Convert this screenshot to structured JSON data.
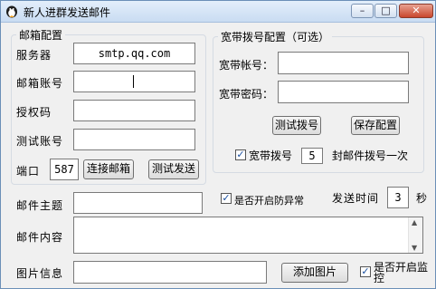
{
  "window": {
    "title": "新人进群发送邮件",
    "minimize_icon": "minimize-icon",
    "maximize_icon": "maximize-icon",
    "close_icon": "close-icon"
  },
  "mail_config": {
    "legend": "邮箱配置",
    "server_label": "服务器",
    "server_value": "smtp.qq.com",
    "account_label": "邮箱账号",
    "account_value": "",
    "auth_label": "授权码",
    "auth_value": "",
    "test_account_label": "测试账号",
    "test_account_value": "",
    "port_label": "端口",
    "port_value": "587",
    "connect_button": "连接邮箱",
    "test_send_button": "测试发送"
  },
  "broadband_config": {
    "legend": "宽带拨号配置（可选）",
    "account_label": "宽带帐号：",
    "account_value": "",
    "password_label": "宽带密码：",
    "password_value": "",
    "test_dial_button": "测试拨号",
    "save_button": "保存配置",
    "dial_checkbox_label": "宽带拨号",
    "dial_checked": true,
    "dial_every_value": "5",
    "dial_every_suffix": "封邮件拨号一次"
  },
  "mail": {
    "subject_label": "邮件主题",
    "subject_value": "",
    "anti_exception_label": "是否开启防异常",
    "anti_exception_checked": true,
    "send_interval_label": "发送时间",
    "send_interval_value": "3",
    "send_interval_unit": "秒",
    "content_label": "邮件内容",
    "content_value": "",
    "image_label": "图片信息",
    "image_value": "",
    "add_image_button": "添加图片",
    "monitor_label": "是否开启监控",
    "monitor_checked": true
  },
  "colors": {
    "titlebar_top": "#e3eefb",
    "titlebar_bottom": "#c9dcf2",
    "close_button": "#c9472d",
    "window_bg": "#f0f0f0"
  }
}
